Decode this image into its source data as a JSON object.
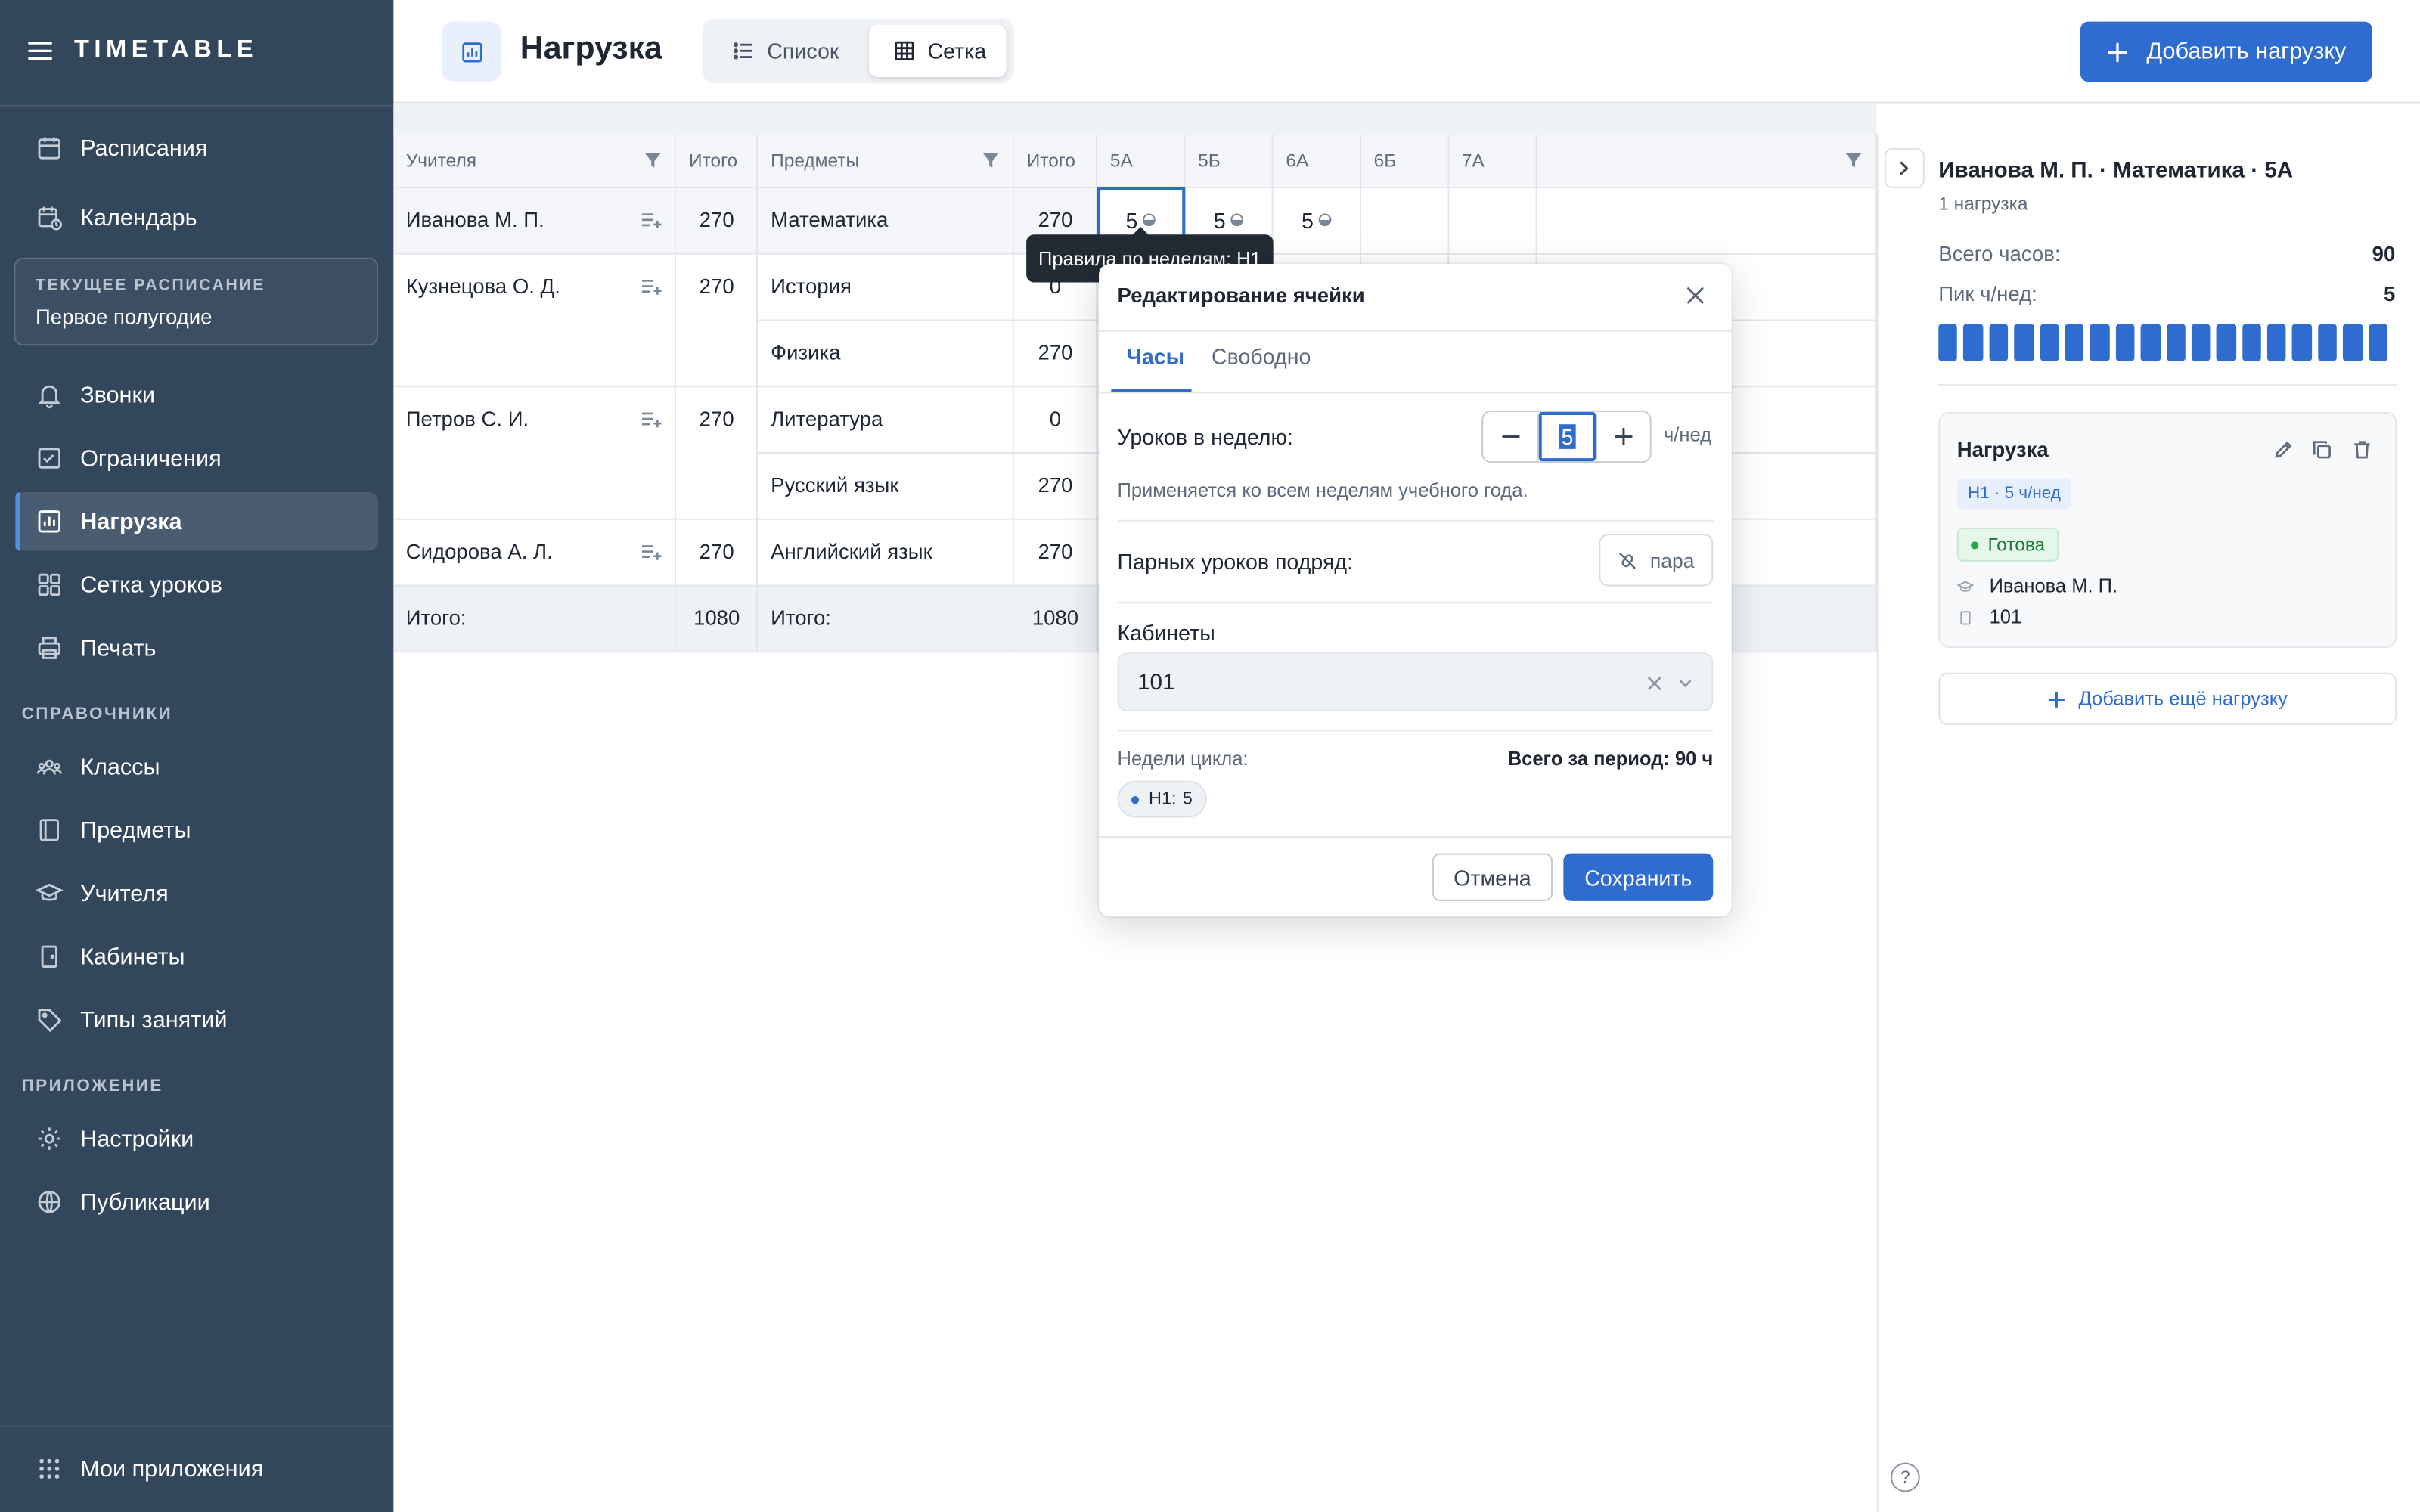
{
  "app": {
    "brand": "TIMETABLE"
  },
  "sidebar": {
    "nav_top": [
      {
        "label": "Расписания",
        "icon": "calendar-icon"
      },
      {
        "label": "Календарь",
        "icon": "calendar-clock-icon"
      }
    ],
    "current_schedule": {
      "label": "ТЕКУЩЕЕ РАСПИСАНИЕ",
      "value": "Первое полугодие"
    },
    "nav_main": [
      {
        "label": "Звонки",
        "icon": "bell-icon"
      },
      {
        "label": "Ограничения",
        "icon": "constraints-icon"
      },
      {
        "label": "Нагрузка",
        "icon": "chart-icon",
        "active": true
      },
      {
        "label": "Сетка уроков",
        "icon": "grid-icon"
      },
      {
        "label": "Печать",
        "icon": "printer-icon"
      }
    ],
    "section_refs": "СПРАВОЧНИКИ",
    "nav_refs": [
      {
        "label": "Классы",
        "icon": "group-icon"
      },
      {
        "label": "Предметы",
        "icon": "book-icon"
      },
      {
        "label": "Учителя",
        "icon": "graduation-cap-icon"
      },
      {
        "label": "Кабинеты",
        "icon": "door-icon"
      },
      {
        "label": "Типы занятий",
        "icon": "tag-icon"
      }
    ],
    "section_app": "ПРИЛОЖЕНИЕ",
    "nav_app": [
      {
        "label": "Настройки",
        "icon": "gear-icon"
      },
      {
        "label": "Публикации",
        "icon": "globe-icon"
      }
    ],
    "bottom": {
      "label": "Мои приложения",
      "icon": "apps-grid-icon"
    }
  },
  "header": {
    "title": "Нагрузка",
    "view_tabs": [
      {
        "label": "Список",
        "active": false
      },
      {
        "label": "Сетка",
        "active": true
      }
    ],
    "add_button": "Добавить нагрузку"
  },
  "grid": {
    "columns": {
      "teachers": "Учителя",
      "teacher_total": "Итого",
      "subjects": "Предметы",
      "subject_total": "Итого",
      "classes": [
        "5А",
        "5Б",
        "6А",
        "6Б",
        "7А"
      ]
    },
    "teachers": [
      {
        "name": "Иванова М. П.",
        "total": "270",
        "subjects": [
          {
            "name": "Математика",
            "total": "270",
            "cells": [
              "5",
              "5",
              "5",
              "",
              ""
            ]
          }
        ]
      },
      {
        "name": "Кузнецова О. Д.",
        "total": "270",
        "subjects": [
          {
            "name": "История",
            "total": "0",
            "cells": [
              "",
              "",
              "",
              "",
              ""
            ]
          },
          {
            "name": "Физика",
            "total": "270",
            "cells": [
              "",
              "",
              "",
              "",
              ""
            ]
          }
        ]
      },
      {
        "name": "Петров С. И.",
        "total": "270",
        "subjects": [
          {
            "name": "Литература",
            "total": "0",
            "cells": [
              "",
              "",
              "",
              "",
              ""
            ]
          },
          {
            "name": "Русский язык",
            "total": "270",
            "cells": [
              "",
              "",
              "",
              "",
              ""
            ]
          }
        ]
      },
      {
        "name": "Сидорова А. Л.",
        "total": "270",
        "subjects": [
          {
            "name": "Английский язык",
            "total": "270",
            "cells": [
              "",
              "",
              "",
              "",
              ""
            ]
          }
        ]
      }
    ],
    "totals": {
      "label_teachers": "Итого:",
      "teachers_total": "1080",
      "label_subjects": "Итого:",
      "subjects_total": "1080"
    }
  },
  "tooltip": "Правила по неделям: Н1",
  "cell_editor": {
    "title": "Редактирование ячейки",
    "tabs": [
      {
        "label": "Часы",
        "active": true
      },
      {
        "label": "Свободно",
        "active": false
      }
    ],
    "lessons_per_week_label": "Уроков в неделю:",
    "lessons_per_week_value": "5",
    "unit": "ч/нед",
    "hint": "Применяется ко всем неделям учебного года.",
    "paired_label": "Парных уроков подряд:",
    "paired_button": "пара",
    "rooms_label": "Кабинеты",
    "rooms_value": "101",
    "cycle_label": "Недели цикла:",
    "period_total": "Всего за период: 90 ч",
    "week_chip": {
      "name": "Н1:",
      "value": "5"
    },
    "cancel": "Отмена",
    "save": "Сохранить"
  },
  "right_panel": {
    "title": "Иванова М. П. · Математика · 5А",
    "subtitle": "1 нагрузка",
    "total_hours_label": "Всего часов:",
    "total_hours_value": "90",
    "peak_label": "Пик ч/нед:",
    "peak_value": "5",
    "week_bars": [
      5,
      5,
      5,
      5,
      5,
      5,
      5,
      5,
      5,
      5,
      5,
      5,
      5,
      5,
      5,
      5,
      5,
      5
    ],
    "card": {
      "title": "Нагрузка",
      "tag": "Н1 · 5 ч/нед",
      "status": "Готова",
      "teacher": "Иванова М. П.",
      "room": "101"
    },
    "add_more": "Добавить ещё нагрузку",
    "help": "?"
  },
  "colors": {
    "sidebar_bg": "#32465c",
    "accent": "#2f6ccf",
    "success": "#28a745"
  }
}
